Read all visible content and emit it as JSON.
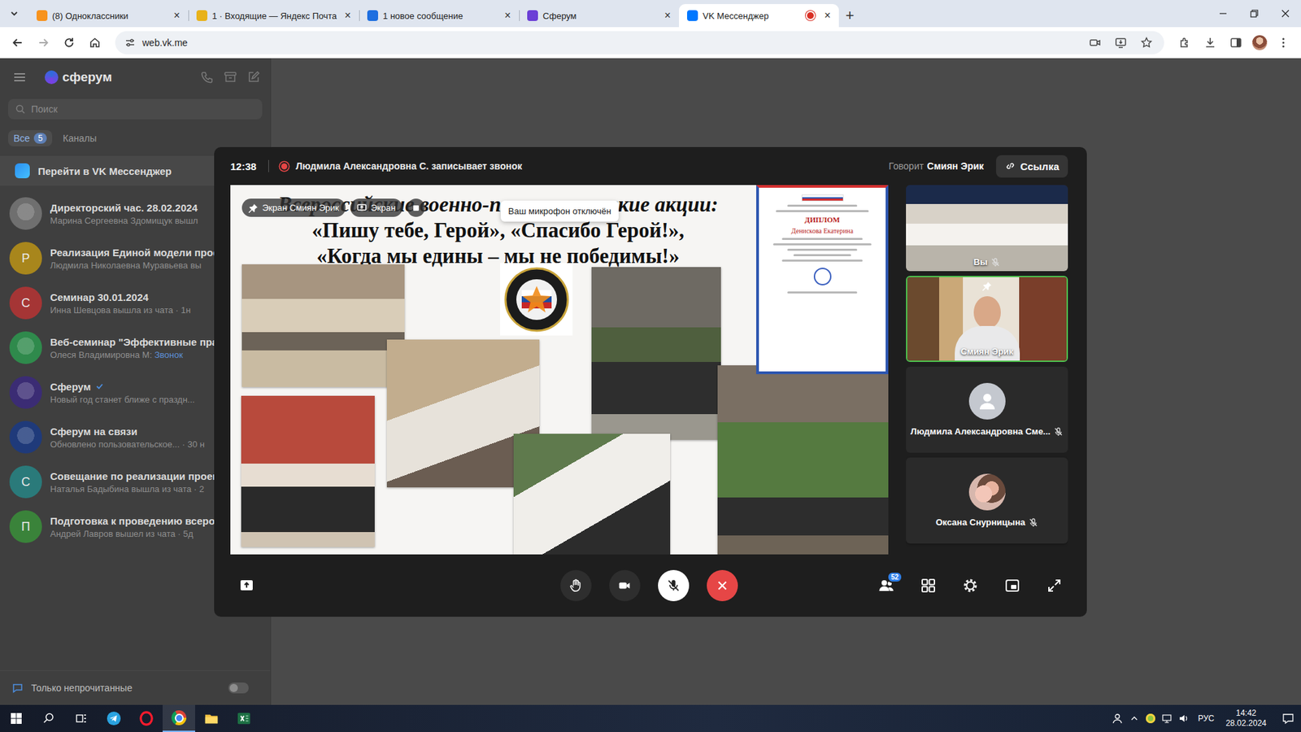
{
  "browser": {
    "tabs": [
      {
        "label": "(8) Одноклассники",
        "selected": false,
        "recording": false,
        "color": "#f7931e"
      },
      {
        "label": "1 · Входящие — Яндекс Почта",
        "selected": false,
        "recording": false,
        "color": "#e8b21a"
      },
      {
        "label": "1 новое сообщение",
        "selected": false,
        "recording": false,
        "color": "#1e6fe0"
      },
      {
        "label": "Сферум",
        "selected": false,
        "recording": false,
        "color": "#6b3fd6"
      },
      {
        "label": "VK Мессенджер",
        "selected": true,
        "recording": true,
        "color": "#0077ff"
      }
    ],
    "close_glyph": "×",
    "new_tab": "+",
    "url": "web.vk.me"
  },
  "sidebar": {
    "brand": "сферум",
    "search_placeholder": "Поиск",
    "filters": [
      {
        "label": "Все",
        "count": "5",
        "selected": true
      },
      {
        "label": "Каналы",
        "count": "",
        "selected": false
      }
    ],
    "vk_link": "Перейти в VK Мессенджер",
    "chats": [
      {
        "title": "Директорский час. 28.02.2024",
        "preview": "Марина Сергеевна Здомищук вышл",
        "link": "",
        "kind": "image",
        "letter": "",
        "verified": false,
        "color": "#6f6f6f"
      },
      {
        "title": "Реализация Единой модели профе",
        "preview": "Людмила Николаевна Муравьева вы",
        "link": "",
        "kind": "letter",
        "letter": "Р",
        "verified": false,
        "color": "#a8861c"
      },
      {
        "title": "Семинар 30.01.2024",
        "preview": "Инна Шевцова вышла из чата · 1н",
        "link": "",
        "kind": "letter",
        "letter": "С",
        "verified": false,
        "color": "#a53535"
      },
      {
        "title": "Веб-семинар \"Эффективные практ",
        "preview": "Олеся Владимировна М: ",
        "link": "Звонок",
        "kind": "image",
        "letter": "",
        "verified": false,
        "color": "#2f8a4c"
      },
      {
        "title": "Сферум",
        "preview": "Новый год станет ближе с праздн...",
        "link": "",
        "kind": "image",
        "letter": "",
        "verified": true,
        "color": "#3b2c74"
      },
      {
        "title": "Сферум на связи",
        "preview": "Обновлено пользовательское... · 30 н",
        "link": "",
        "kind": "image",
        "letter": "",
        "verified": false,
        "color": "#1f3a7a"
      },
      {
        "title": "Совещание по реализации проект",
        "preview": "Наталья Бадыбина вышла из чата · 2",
        "link": "",
        "kind": "letter",
        "letter": "С",
        "verified": false,
        "color": "#2a7a7a"
      },
      {
        "title": "Подготовка к проведению всерос",
        "preview": "Андрей Лавров вышел из чата · 5д",
        "link": "",
        "kind": "letter",
        "letter": "П",
        "verified": false,
        "color": "#3a833a"
      }
    ],
    "unread_only": {
      "label": "Только непрочитанные",
      "on": false
    }
  },
  "call": {
    "elapsed": "12:38",
    "recording_text": "Людмила Александровна С. записывает звонок",
    "speaker_label": "Говорит",
    "speaker_name": "Смиян Эрик",
    "link_button": "Ссылка",
    "share": {
      "badges": [
        {
          "label": "Экран Смиян Эрик",
          "kind": "pin"
        },
        {
          "label": "Экран",
          "kind": "screen"
        }
      ],
      "tooltip": "Ваш микрофон отключён",
      "slide": {
        "title_lines": [
          "Всероссийские военно-патриотические акции:",
          "«Пишу тебе, Герой», «Спасибо Герой!»,",
          "«Когда мы едины – мы не победимы!»"
        ],
        "diploma": {
          "heading": "ДИПЛОМ",
          "name": "Денискова Екатерина"
        }
      }
    },
    "participants": [
      {
        "name": "Вы",
        "kind": "desk",
        "muted": true,
        "pinned": false,
        "selected": false
      },
      {
        "name": "Смиян Эрик",
        "kind": "camera",
        "muted": false,
        "pinned": true,
        "selected": true
      },
      {
        "name": "Людмила Александровна Сме...",
        "kind": "placeholder",
        "muted": true,
        "pinned": false,
        "selected": false
      },
      {
        "name": "Оксана Снурницына",
        "kind": "photo",
        "muted": true,
        "pinned": false,
        "selected": false
      }
    ],
    "controls": {
      "participants_count": "52",
      "mic_muted": true
    }
  },
  "taskbar": {
    "apps": [
      {
        "kind": "telegram",
        "active": false
      },
      {
        "kind": "opera",
        "active": false
      },
      {
        "kind": "chrome",
        "active": true
      },
      {
        "kind": "explorer",
        "active": false
      },
      {
        "kind": "excel",
        "active": false
      }
    ],
    "lang": "РУС",
    "time": "14:42",
    "date": "28.02.2024"
  }
}
